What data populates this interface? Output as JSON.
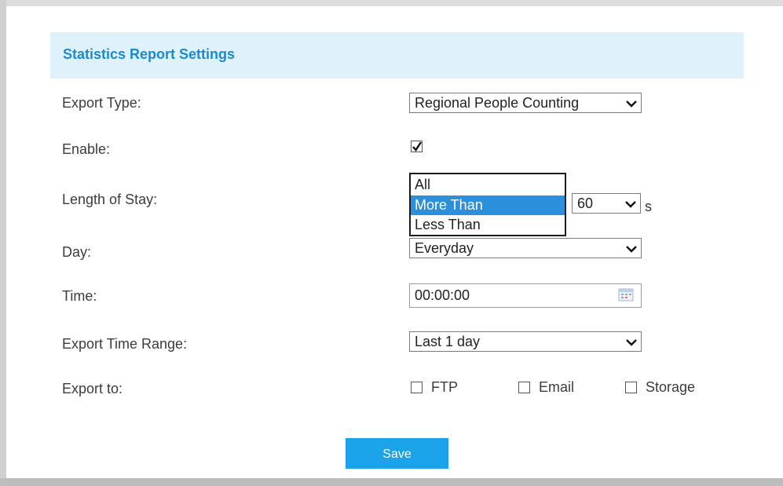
{
  "panel": {
    "title": "Statistics Report Settings"
  },
  "fields": {
    "export_type": {
      "label": "Export Type:",
      "value": "Regional People Counting"
    },
    "enable": {
      "label": "Enable:",
      "checked": true
    },
    "length_of_stay": {
      "label": "Length of Stay:",
      "options": [
        "All",
        "More Than",
        "Less Than"
      ],
      "selected": "More Than",
      "seconds_value": "60",
      "unit": "s"
    },
    "day": {
      "label": "Day:",
      "value": "Everyday"
    },
    "time": {
      "label": "Time:",
      "value": "00:00:00"
    },
    "export_time_range": {
      "label": "Export Time Range:",
      "value": "Last 1 day"
    },
    "export_to": {
      "label": "Export to:",
      "options": [
        {
          "label": "FTP",
          "checked": false
        },
        {
          "label": "Email",
          "checked": false
        },
        {
          "label": "Storage",
          "checked": false
        }
      ]
    }
  },
  "actions": {
    "save_label": "Save"
  },
  "colors": {
    "header_bg": "#dff2fc",
    "title": "#1a8ad4",
    "selected_option": "#2b8fdc",
    "save_button": "#1aa3e8"
  }
}
